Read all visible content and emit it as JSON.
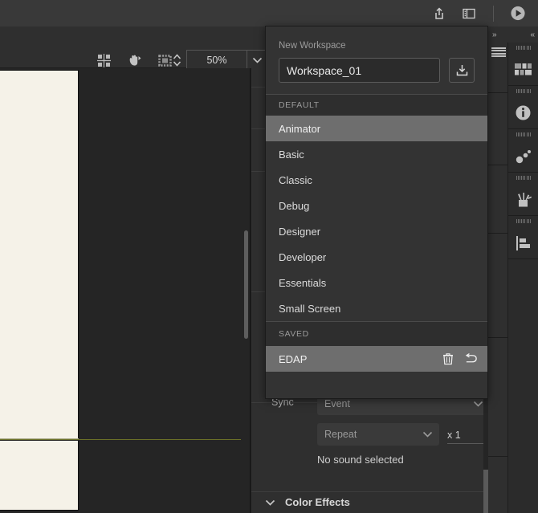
{
  "colors": {
    "app_bg": "#252525",
    "panel_bg": "#2f2f2f",
    "popup_bg": "#333333",
    "highlight": "#6e6e6e",
    "text": "#dcdcdc",
    "muted_text": "#9b9b9b",
    "document_paper": "#f5f2e8",
    "guide_line": "#6a7028"
  },
  "topbar": {
    "icons": [
      {
        "name": "share-export-icon",
        "label": "Share / Export"
      },
      {
        "name": "panel-layout-icon",
        "label": "Panel Layout"
      }
    ],
    "play_button": {
      "name": "play-test-icon",
      "label": "Test Movie"
    }
  },
  "toolbar": {
    "tools": [
      {
        "name": "transform-tool-icon",
        "label": "Free Transform"
      },
      {
        "name": "hand-paint-tool-icon",
        "label": "Paint Bucket"
      },
      {
        "name": "crop-frame-tool-icon",
        "label": "Edit Multiple Frames"
      }
    ],
    "zoom": {
      "value": "50%",
      "placeholder": "100%",
      "stepper_name": "zoom-stepper",
      "dropdown_name": "zoom-dropdown"
    }
  },
  "popup": {
    "title": "New Workspace",
    "input": {
      "value": "Workspace_01",
      "placeholder": "Workspace name"
    },
    "save_button_label": "Save Workspace",
    "groups": [
      {
        "header": "DEFAULT",
        "items": [
          {
            "label": "Animator",
            "selected": true,
            "actions": []
          },
          {
            "label": "Basic",
            "selected": false,
            "actions": []
          },
          {
            "label": "Classic",
            "selected": false,
            "actions": []
          },
          {
            "label": "Debug",
            "selected": false,
            "actions": []
          },
          {
            "label": "Designer",
            "selected": false,
            "actions": []
          },
          {
            "label": "Developer",
            "selected": false,
            "actions": []
          },
          {
            "label": "Essentials",
            "selected": false,
            "actions": []
          },
          {
            "label": "Small Screen",
            "selected": false,
            "actions": []
          }
        ]
      },
      {
        "header": "SAVED",
        "items": [
          {
            "label": "EDAP",
            "selected": true,
            "actions": [
              "delete-icon",
              "revert-icon"
            ]
          }
        ]
      }
    ]
  },
  "properties": {
    "sync_row": {
      "label": "Sync",
      "value": "Event"
    },
    "repeat_row": {
      "value": "Repeat",
      "count_label": "x 1"
    },
    "sound_status": "No sound selected",
    "color_effects_section": {
      "label": "Color Effects",
      "expanded": true
    }
  },
  "dock": {
    "expand_arrows": "»",
    "collapse_arrows": "«",
    "menu_name": "panel-menu-icon",
    "tabs": [
      {
        "name": "library-grid-icon",
        "label": "Library"
      },
      {
        "name": "info-icon",
        "label": "Info"
      },
      {
        "name": "particles-dots-icon",
        "label": "Transform"
      },
      {
        "name": "tools-brushes-icon",
        "label": "Tools"
      },
      {
        "name": "align-icon",
        "label": "Align"
      }
    ]
  }
}
